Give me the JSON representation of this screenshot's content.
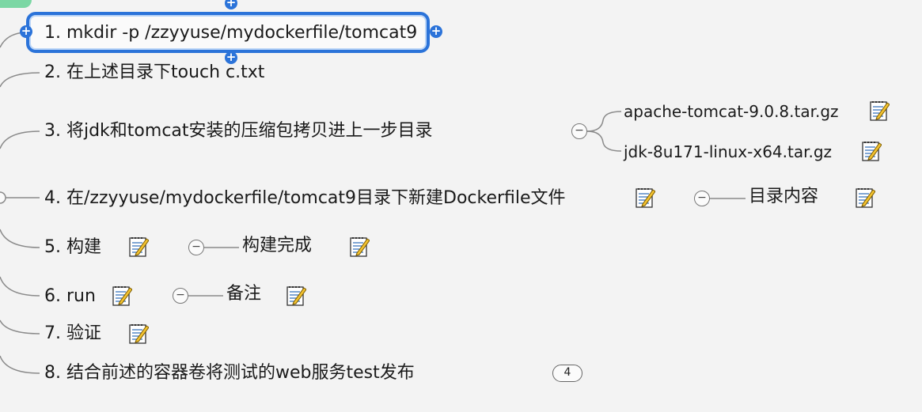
{
  "colors": {
    "selection": "#2b73d9",
    "line": "#8a8a8a",
    "background": "#f3f3f3"
  },
  "nodes": [
    {
      "label": "1. mkdir -p /zzyyuse/mydockerfile/tomcat9"
    },
    {
      "label": "2. 在上述目录下touch c.txt"
    },
    {
      "label": "3. 将jdk和tomcat安装的压缩包拷贝进上一步目录"
    },
    {
      "label": "4. 在/zzyyuse/mydockerfile/tomcat9目录下新建Dockerfile文件"
    },
    {
      "label": "5. 构建"
    },
    {
      "label": "6. run"
    },
    {
      "label": "7. 验证"
    },
    {
      "label": "8. 结合前述的容器卷将测试的web服务test发布"
    }
  ],
  "subnodes": {
    "node3_files": [
      "apache-tomcat-9.0.8.tar.gz",
      "jdk-8u171-linux-x64.tar.gz"
    ],
    "node4_child": "目录内容",
    "node5_child": "构建完成",
    "node6_child": "备注"
  },
  "collapsed_count": "4",
  "icons": {
    "note": "note-pencil-icon",
    "expand": "plus-icon",
    "collapse": "minus-icon"
  }
}
